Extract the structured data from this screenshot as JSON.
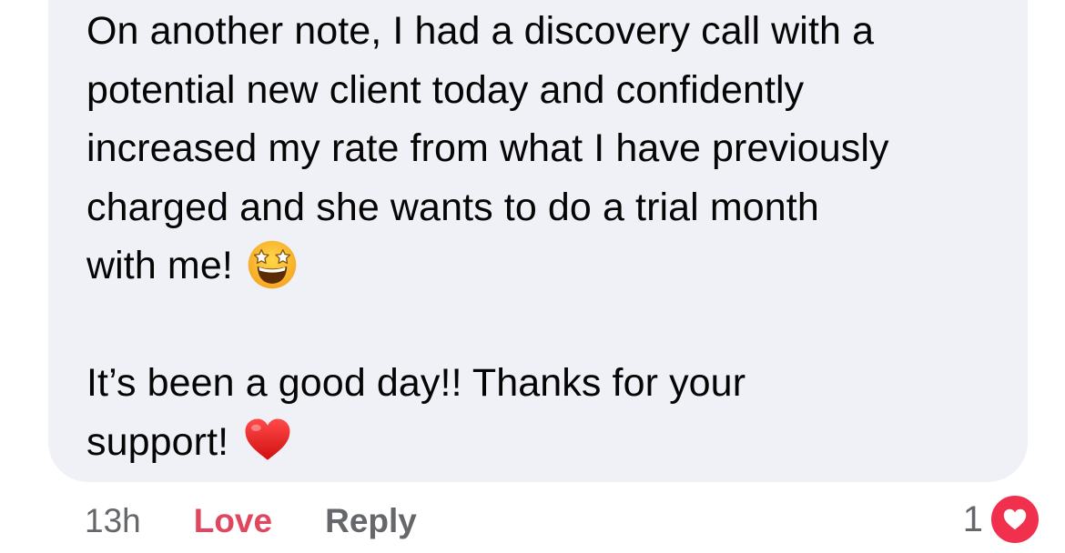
{
  "comment": {
    "lines": [
      "On another note, I had a discovery call with a",
      "potential new client today and confidently",
      "increased my rate from what I have previously",
      "charged and she wants to do a trial month",
      "with me!",
      "It’s been a good day!! Thanks for your",
      "support!"
    ],
    "emojis": {
      "star_struck": "star-struck-emoji",
      "heart": "red-heart-emoji"
    }
  },
  "actions": {
    "timestamp": "13h",
    "love_label": "Love",
    "reply_label": "Reply"
  },
  "reactions": {
    "count": "1",
    "icon": "heart-icon"
  },
  "colors": {
    "bubble": "#f0f1f6",
    "love_active": "#e0475f",
    "secondary_text": "#65676b",
    "heart_badge": "#f1304d"
  }
}
